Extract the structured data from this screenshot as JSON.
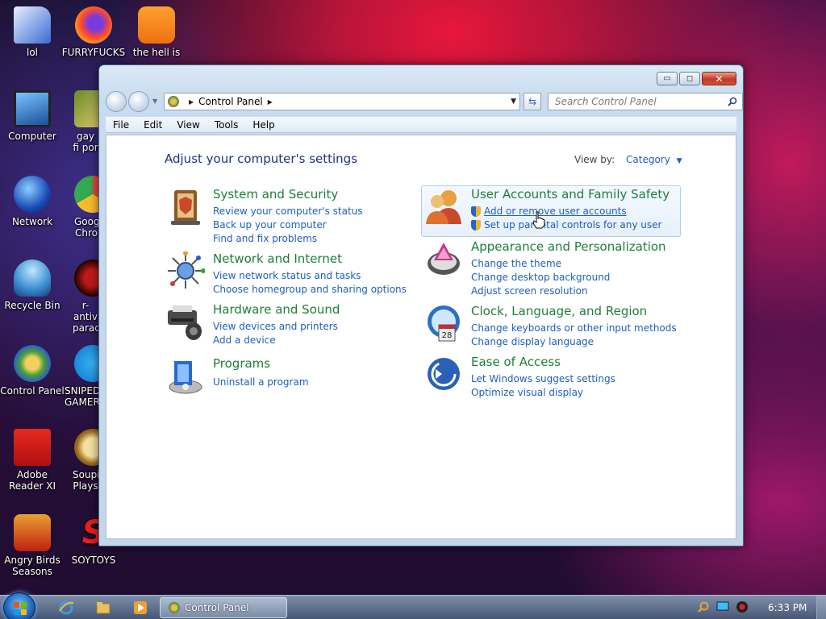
{
  "desktop": {
    "icons": [
      {
        "label": "lol"
      },
      {
        "label": "FURRYFUCKS"
      },
      {
        "label": "the hell is"
      },
      {
        "label": "Computer"
      },
      {
        "label": "gay fi por"
      },
      {
        "label": "Network"
      },
      {
        "label": "Goog Chro"
      },
      {
        "label": "Recycle Bin"
      },
      {
        "label": "r-antiv parac"
      },
      {
        "label": "Control Panel"
      },
      {
        "label": "SNIPED! GAMER"
      },
      {
        "label": "Adobe Reader XI"
      },
      {
        "label": "Soupi Plays"
      },
      {
        "label": "Angry Birds Seasons"
      },
      {
        "label": "SOYTOYS"
      }
    ]
  },
  "window": {
    "caption": {
      "minimize": "▭",
      "maximize": "◻",
      "close": "✕"
    },
    "address": {
      "crumb": "Control Panel"
    },
    "search": {
      "placeholder": "Search Control Panel"
    },
    "menu": [
      "File",
      "Edit",
      "View",
      "Tools",
      "Help"
    ],
    "heading": "Adjust your computer's settings",
    "view_by": {
      "label": "View by:",
      "value": "Category"
    },
    "categories": [
      {
        "title": "System and Security",
        "links": [
          "Review your computer's status",
          "Back up your computer",
          "Find and fix problems"
        ]
      },
      {
        "title": "Network and Internet",
        "links": [
          "View network status and tasks",
          "Choose homegroup and sharing options"
        ]
      },
      {
        "title": "Hardware and Sound",
        "links": [
          "View devices and printers",
          "Add a device"
        ]
      },
      {
        "title": "Programs",
        "links": [
          "Uninstall a program"
        ]
      },
      {
        "title": "User Accounts and Family Safety",
        "links": [
          "Add or remove user accounts",
          "Set up parental controls for any user"
        ]
      },
      {
        "title": "Appearance and Personalization",
        "links": [
          "Change the theme",
          "Change desktop background",
          "Adjust screen resolution"
        ]
      },
      {
        "title": "Clock, Language, and Region",
        "links": [
          "Change keyboards or other input methods",
          "Change display language"
        ]
      },
      {
        "title": "Ease of Access",
        "links": [
          "Let Windows suggest settings",
          "Optimize visual display"
        ]
      }
    ]
  },
  "taskbar": {
    "active_task": "Control Panel",
    "clock": "6:33 PM"
  },
  "colors": {
    "category_title": "#1e7e3a",
    "link": "#1e5ebc",
    "heading": "#1e3287"
  }
}
